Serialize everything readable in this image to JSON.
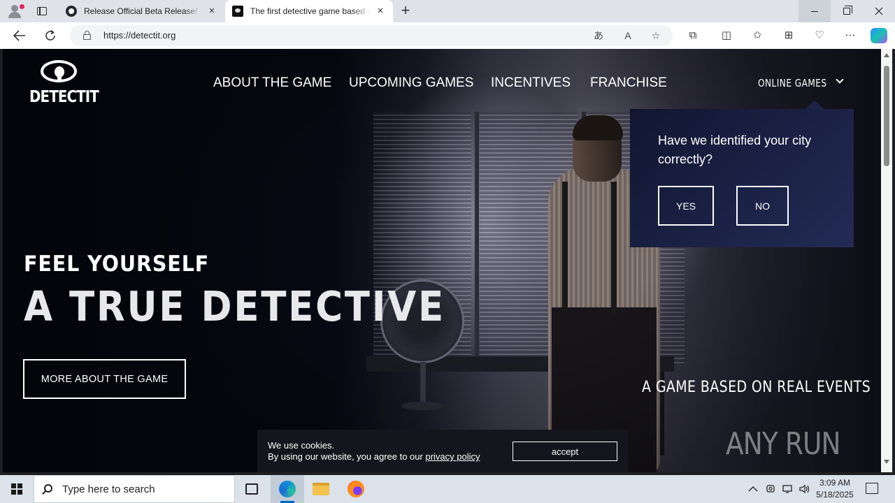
{
  "browser": {
    "tabs": [
      {
        "title": "Release Official Beta Release! · Bl",
        "favicon": "github-icon",
        "active": false
      },
      {
        "title": "The first detective game based on",
        "favicon": "detectit-icon",
        "active": true
      }
    ],
    "url": "https://detectit.org",
    "close_glyph": "×",
    "new_tab_glyph": "+"
  },
  "site": {
    "logo_text": "DETECTIT",
    "nav": [
      {
        "label": "ABOUT THE GAME"
      },
      {
        "label": "UPCOMING GAMES"
      },
      {
        "label": "INCENTIVES"
      },
      {
        "label": "FRANCHISE"
      }
    ],
    "online_games": "ONLINE GAMES",
    "hero_small": "FEEL YOURSELF",
    "hero_big": "A TRUE DETECTIVE",
    "hero_button": "MORE ABOUT THE GAME",
    "tagline": "A GAME BASED ON REAL EVENTS"
  },
  "city_popup": {
    "question": "Have we identified your city correctly?",
    "yes": "YES",
    "no": "NO"
  },
  "cookie": {
    "line1": "We use cookies.",
    "line2_prefix": "By using our website, you agree to our ",
    "link": "privacy policy",
    "accept": "accept"
  },
  "watermark": "ANY RUN",
  "taskbar": {
    "search_placeholder": "Type here to search",
    "time": "3:09 AM",
    "date": "5/18/2025"
  },
  "colors": {
    "popup_bg": "#1a2045",
    "accent_edge": "#0f8ad8"
  }
}
